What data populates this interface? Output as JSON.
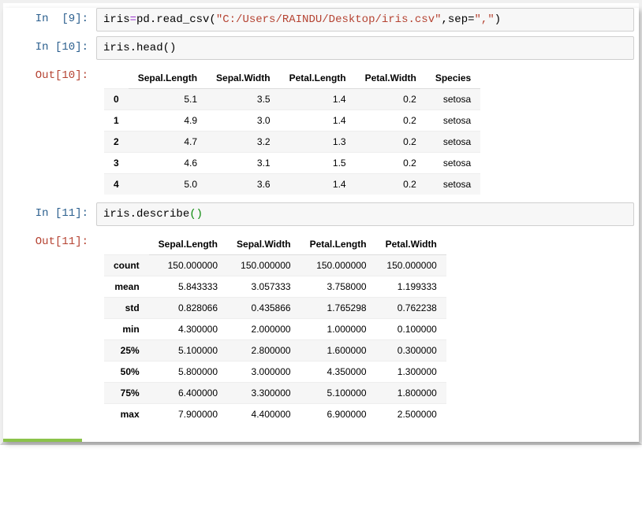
{
  "cells": {
    "in9": {
      "label": "In  [9]:",
      "pre": "iris",
      "op": "=",
      "call": "pd.read_csv(",
      "str1": "\"C:/Users/RAINDU/Desktop/iris.csv\"",
      "mid": ",sep=",
      "str2": "\",\"",
      "close": ")"
    },
    "in10": {
      "label": "In [10]:",
      "code": "iris.head()"
    },
    "out10": {
      "label": "Out[10]:"
    },
    "in11": {
      "label": "In [11]:",
      "code_pre": "iris.describe",
      "paren_open": "(",
      "paren_close": ")"
    },
    "out11": {
      "label": "Out[11]:"
    }
  },
  "head_table": {
    "columns": [
      "Sepal.Length",
      "Sepal.Width",
      "Petal.Length",
      "Petal.Width",
      "Species"
    ],
    "index": [
      "0",
      "1",
      "2",
      "3",
      "4"
    ],
    "rows": [
      [
        "5.1",
        "3.5",
        "1.4",
        "0.2",
        "setosa"
      ],
      [
        "4.9",
        "3.0",
        "1.4",
        "0.2",
        "setosa"
      ],
      [
        "4.7",
        "3.2",
        "1.3",
        "0.2",
        "setosa"
      ],
      [
        "4.6",
        "3.1",
        "1.5",
        "0.2",
        "setosa"
      ],
      [
        "5.0",
        "3.6",
        "1.4",
        "0.2",
        "setosa"
      ]
    ]
  },
  "describe_table": {
    "columns": [
      "Sepal.Length",
      "Sepal.Width",
      "Petal.Length",
      "Petal.Width"
    ],
    "index": [
      "count",
      "mean",
      "std",
      "min",
      "25%",
      "50%",
      "75%",
      "max"
    ],
    "rows": [
      [
        "150.000000",
        "150.000000",
        "150.000000",
        "150.000000"
      ],
      [
        "5.843333",
        "3.057333",
        "3.758000",
        "1.199333"
      ],
      [
        "0.828066",
        "0.435866",
        "1.765298",
        "0.762238"
      ],
      [
        "4.300000",
        "2.000000",
        "1.000000",
        "0.100000"
      ],
      [
        "5.100000",
        "2.800000",
        "1.600000",
        "0.300000"
      ],
      [
        "5.800000",
        "3.000000",
        "4.350000",
        "1.300000"
      ],
      [
        "6.400000",
        "3.300000",
        "5.100000",
        "1.800000"
      ],
      [
        "7.900000",
        "4.400000",
        "6.900000",
        "2.500000"
      ]
    ]
  }
}
